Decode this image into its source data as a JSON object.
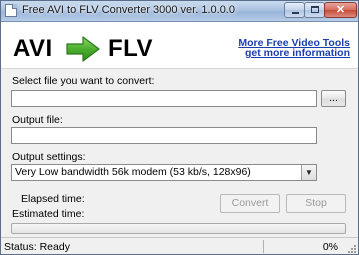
{
  "window": {
    "title": "Free AVI to FLV Converter 3000 ver. 1.0.0.0"
  },
  "header": {
    "source_format": "AVI",
    "target_format": "FLV",
    "link_more_tools": "More Free Video Tools",
    "link_more_info": "get more information"
  },
  "form": {
    "input_label": "Select file you want to convert:",
    "input_value": "",
    "browse_label": "...",
    "output_label": "Output file:",
    "output_value": "",
    "settings_label": "Output settings:",
    "settings_selected": "Very Low bandwidth 56k modem (53 kb/s, 128x96)",
    "elapsed_label": "Elapsed time:",
    "estimated_label": "Estimated time:",
    "convert_label": "Convert",
    "stop_label": "Stop"
  },
  "progress": {
    "value": 0
  },
  "status": {
    "text": "Status: Ready",
    "percent": "0%"
  },
  "colors": {
    "arrow": "#4cae2f",
    "link": "#1b3fb0"
  }
}
